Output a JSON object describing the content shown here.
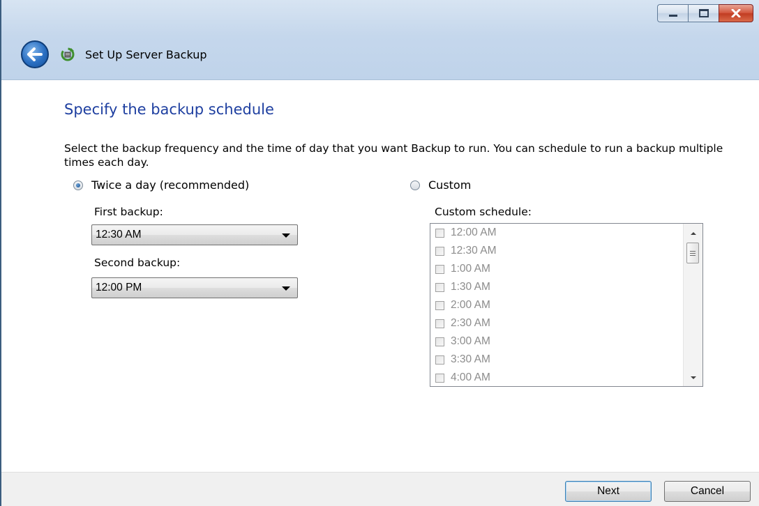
{
  "window": {
    "title": "Set Up Server Backup"
  },
  "page": {
    "heading": "Specify the backup schedule",
    "description": "Select the backup frequency and the time of day that you want Backup to run. You can schedule to run a backup multiple times each day."
  },
  "options": {
    "twice_label": "Twice a day (recommended)",
    "twice_selected": true,
    "custom_label": "Custom",
    "custom_selected": false
  },
  "twice": {
    "first_label": "First backup:",
    "first_value": "12:30 AM",
    "second_label": "Second backup:",
    "second_value": "12:00 PM"
  },
  "custom": {
    "label": "Custom schedule:",
    "items": [
      {
        "label": "12:00 AM",
        "checked": false
      },
      {
        "label": "12:30 AM",
        "checked": false
      },
      {
        "label": "1:00 AM",
        "checked": false
      },
      {
        "label": "1:30 AM",
        "checked": false
      },
      {
        "label": "2:00 AM",
        "checked": false
      },
      {
        "label": "2:30 AM",
        "checked": false
      },
      {
        "label": "3:00 AM",
        "checked": false
      },
      {
        "label": "3:30 AM",
        "checked": false
      },
      {
        "label": "4:00 AM",
        "checked": false
      }
    ]
  },
  "footer": {
    "next_label": "Next",
    "cancel_label": "Cancel"
  },
  "icons": {
    "back": "back-arrow-icon",
    "app": "server-backup-icon",
    "minimize": "minimize-icon",
    "maximize": "maximize-icon",
    "close": "close-icon"
  },
  "colors": {
    "heading": "#1e3fa0",
    "disabled_text": "#8c8c8c",
    "chrome": "#c5d7ec",
    "close_button": "#c13c22"
  }
}
